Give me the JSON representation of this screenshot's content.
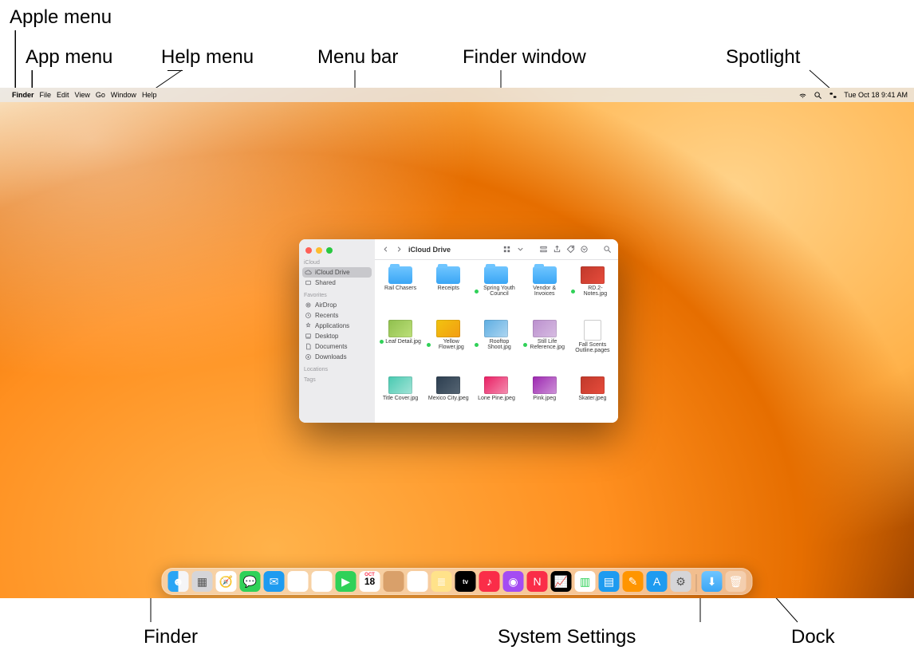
{
  "callouts": {
    "apple_menu": "Apple menu",
    "app_menu": "App menu",
    "help_menu": "Help menu",
    "menu_bar": "Menu bar",
    "finder_window": "Finder window",
    "spotlight": "Spotlight",
    "finder": "Finder",
    "system_settings": "System Settings",
    "dock": "Dock"
  },
  "menubar": {
    "app": "Finder",
    "items": [
      "File",
      "Edit",
      "View",
      "Go",
      "Window",
      "Help"
    ],
    "clock": "Tue Oct 18  9:41 AM"
  },
  "finder": {
    "title": "iCloud Drive",
    "sidebar": {
      "sections": [
        {
          "heading": "iCloud",
          "items": [
            {
              "label": "iCloud Drive",
              "icon": "cloud",
              "selected": true
            },
            {
              "label": "Shared",
              "icon": "shared"
            }
          ]
        },
        {
          "heading": "Favorites",
          "items": [
            {
              "label": "AirDrop",
              "icon": "airdrop"
            },
            {
              "label": "Recents",
              "icon": "clock"
            },
            {
              "label": "Applications",
              "icon": "app"
            },
            {
              "label": "Desktop",
              "icon": "desktop"
            },
            {
              "label": "Documents",
              "icon": "doc"
            },
            {
              "label": "Downloads",
              "icon": "down"
            }
          ]
        },
        {
          "heading": "Locations",
          "items": []
        },
        {
          "heading": "Tags",
          "items": []
        }
      ]
    },
    "files": [
      {
        "name": "Rail Chasers",
        "kind": "folder",
        "tag": false
      },
      {
        "name": "Receipts",
        "kind": "folder",
        "tag": false
      },
      {
        "name": "Spring Youth Council",
        "kind": "folder",
        "tag": true
      },
      {
        "name": "Vendor & Invoices",
        "kind": "folder",
        "tag": false
      },
      {
        "name": "RD.2-Notes.jpg",
        "kind": "image",
        "tag": true
      },
      {
        "name": "Leaf Detail.jpg",
        "kind": "image",
        "tag": true
      },
      {
        "name": "Yellow Flower.jpg",
        "kind": "image",
        "tag": true
      },
      {
        "name": "Rooftop Shoot.jpg",
        "kind": "image",
        "tag": true
      },
      {
        "name": "Still Life Reference.jpg",
        "kind": "image",
        "tag": true
      },
      {
        "name": "Fall Scents Outline.pages",
        "kind": "doc",
        "tag": false
      },
      {
        "name": "Title Cover.jpg",
        "kind": "image",
        "tag": false
      },
      {
        "name": "Mexico City.jpeg",
        "kind": "image",
        "tag": false
      },
      {
        "name": "Lone Pine.jpeg",
        "kind": "image",
        "tag": false
      },
      {
        "name": "Pink.jpeg",
        "kind": "image",
        "tag": false
      },
      {
        "name": "Skater.jpeg",
        "kind": "image",
        "tag": false
      }
    ]
  },
  "dock": {
    "calendar_month": "OCT",
    "calendar_day": "18",
    "apps": [
      "Finder",
      "Launchpad",
      "Safari",
      "Messages",
      "Mail",
      "Maps",
      "Photos",
      "FaceTime",
      "Calendar",
      "Contacts",
      "Reminders",
      "Notes",
      "TV",
      "Music",
      "Podcasts",
      "News",
      "Stocks",
      "Numbers",
      "Keynote",
      "Pages",
      "App Store",
      "System Settings"
    ],
    "right": [
      "Downloads",
      "Trash"
    ]
  }
}
